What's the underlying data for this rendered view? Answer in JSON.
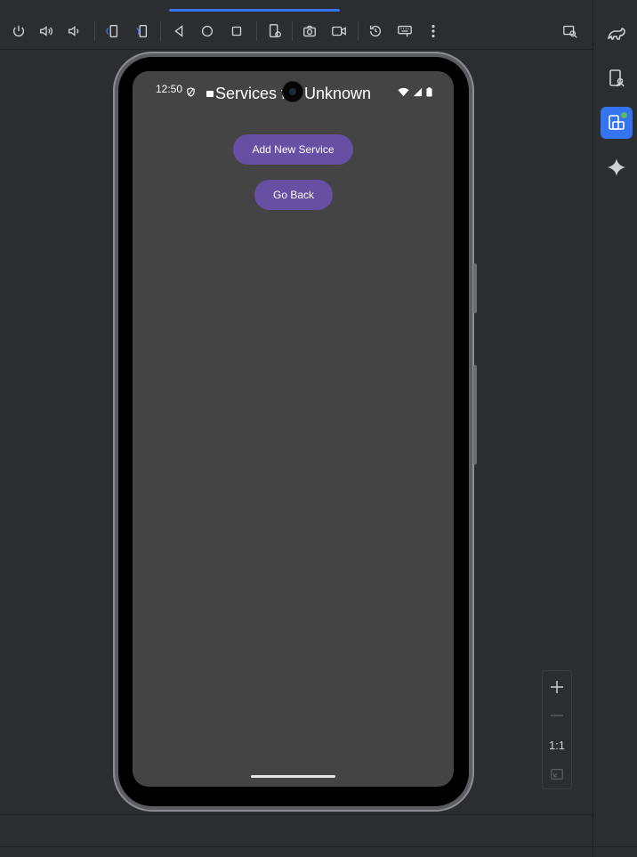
{
  "toolbar": {
    "icons": [
      "power-icon",
      "volume-up-icon",
      "volume-down-icon",
      "rotate-left-icon",
      "rotate-right-icon",
      "back-icon",
      "home-icon",
      "overview-icon",
      "device-settings-icon",
      "screenshot-icon",
      "screen-record-icon",
      "snapshot-icon",
      "extended-controls-icon",
      "more-icon",
      "layout-inspector-icon"
    ]
  },
  "rightbar": {
    "icons": [
      "gradle-icon",
      "device-manager-icon",
      "running-devices-icon",
      "gemini-icon"
    ]
  },
  "device": {
    "status_time": "12:50",
    "app_title": "Services for Unknown",
    "add_button": "Add New Service",
    "back_button": "Go Back"
  },
  "zoom": {
    "actual_size": "1:1"
  },
  "colors": {
    "accent": "#3574f0",
    "button": "#6750a4",
    "screen": "#444444",
    "ide_bg": "#2b2d30"
  }
}
